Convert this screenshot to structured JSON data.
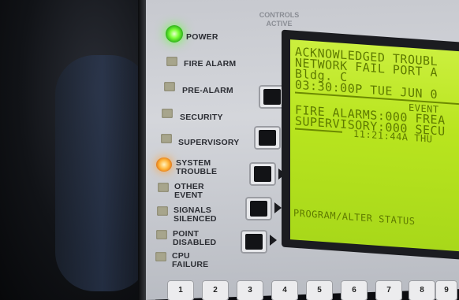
{
  "panel": {
    "controls_active": "CONTROLS ACTIVE",
    "indicators": [
      {
        "label": "POWER",
        "state": "on",
        "color": "#6aff40"
      },
      {
        "label": "FIRE ALARM",
        "state": "off"
      },
      {
        "label": "PRE-ALARM",
        "state": "off"
      },
      {
        "label": "SECURITY",
        "state": "off"
      },
      {
        "label": "SUPERVISORY",
        "state": "off"
      },
      {
        "label": "SYSTEM TROUBLE",
        "state": "on",
        "color": "#ffa640"
      },
      {
        "label": "OTHER EVENT",
        "state": "off"
      },
      {
        "label": "SIGNALS SILENCED",
        "state": "off"
      },
      {
        "label": "POINT DISABLED",
        "state": "off"
      },
      {
        "label": "CPU FAILURE",
        "state": "off"
      }
    ]
  },
  "screen": {
    "lines": [
      "ACKNOWLEDGED TROUBL",
      "NETWORK FAIL PORT A",
      "Bldg. C",
      "03:30:00P TUE JUN 0",
      "EVENT",
      "FIRE ALARMS:000 FREA",
      "SUPERVISORY:000 SECU",
      "11:21:44A THU",
      "PROGRAM/ALTER STATUS"
    ],
    "background_color": "#c3ea2e",
    "text_color": "#5e7a00"
  },
  "keypad": {
    "keys": [
      "1",
      "2",
      "3",
      "4",
      "5",
      "6",
      "7",
      "8",
      "9"
    ]
  }
}
